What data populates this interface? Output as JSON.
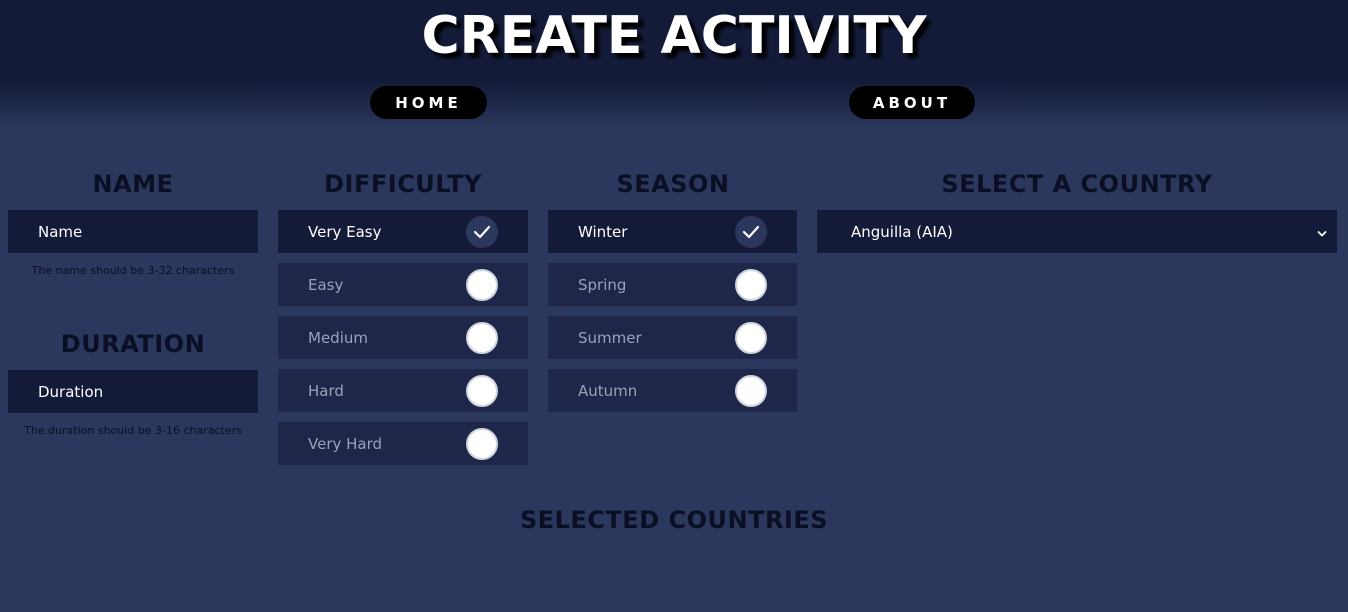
{
  "header": {
    "title": "CREATE ACTIVITY",
    "nav": {
      "home": "HOME",
      "about": "ABOUT"
    }
  },
  "name_section": {
    "title": "NAME",
    "placeholder": "Name",
    "hint": "The name should be 3-32 characters"
  },
  "duration_section": {
    "title": "DURATION",
    "placeholder": "Duration",
    "hint": "The duration should be 3-16 characters"
  },
  "difficulty": {
    "title": "DIFFICULTY",
    "options": [
      {
        "label": "Very Easy",
        "checked": true
      },
      {
        "label": "Easy",
        "checked": false
      },
      {
        "label": "Medium",
        "checked": false
      },
      {
        "label": "Hard",
        "checked": false
      },
      {
        "label": "Very Hard",
        "checked": false
      }
    ]
  },
  "season": {
    "title": "SEASON",
    "options": [
      {
        "label": "Winter",
        "checked": true
      },
      {
        "label": "Spring",
        "checked": false
      },
      {
        "label": "Summer",
        "checked": false
      },
      {
        "label": "Autumn",
        "checked": false
      }
    ]
  },
  "country": {
    "title": "SELECT A COUNTRY",
    "selected": "Anguilla (AIA)"
  },
  "selected_countries": {
    "title": "SELECTED COUNTRIES"
  },
  "colors": {
    "background": "#2b375c",
    "header_dark": "#141b38",
    "input_bg": "#141b38",
    "option_bg": "#1e2749",
    "heading_text": "#0a0f24"
  }
}
